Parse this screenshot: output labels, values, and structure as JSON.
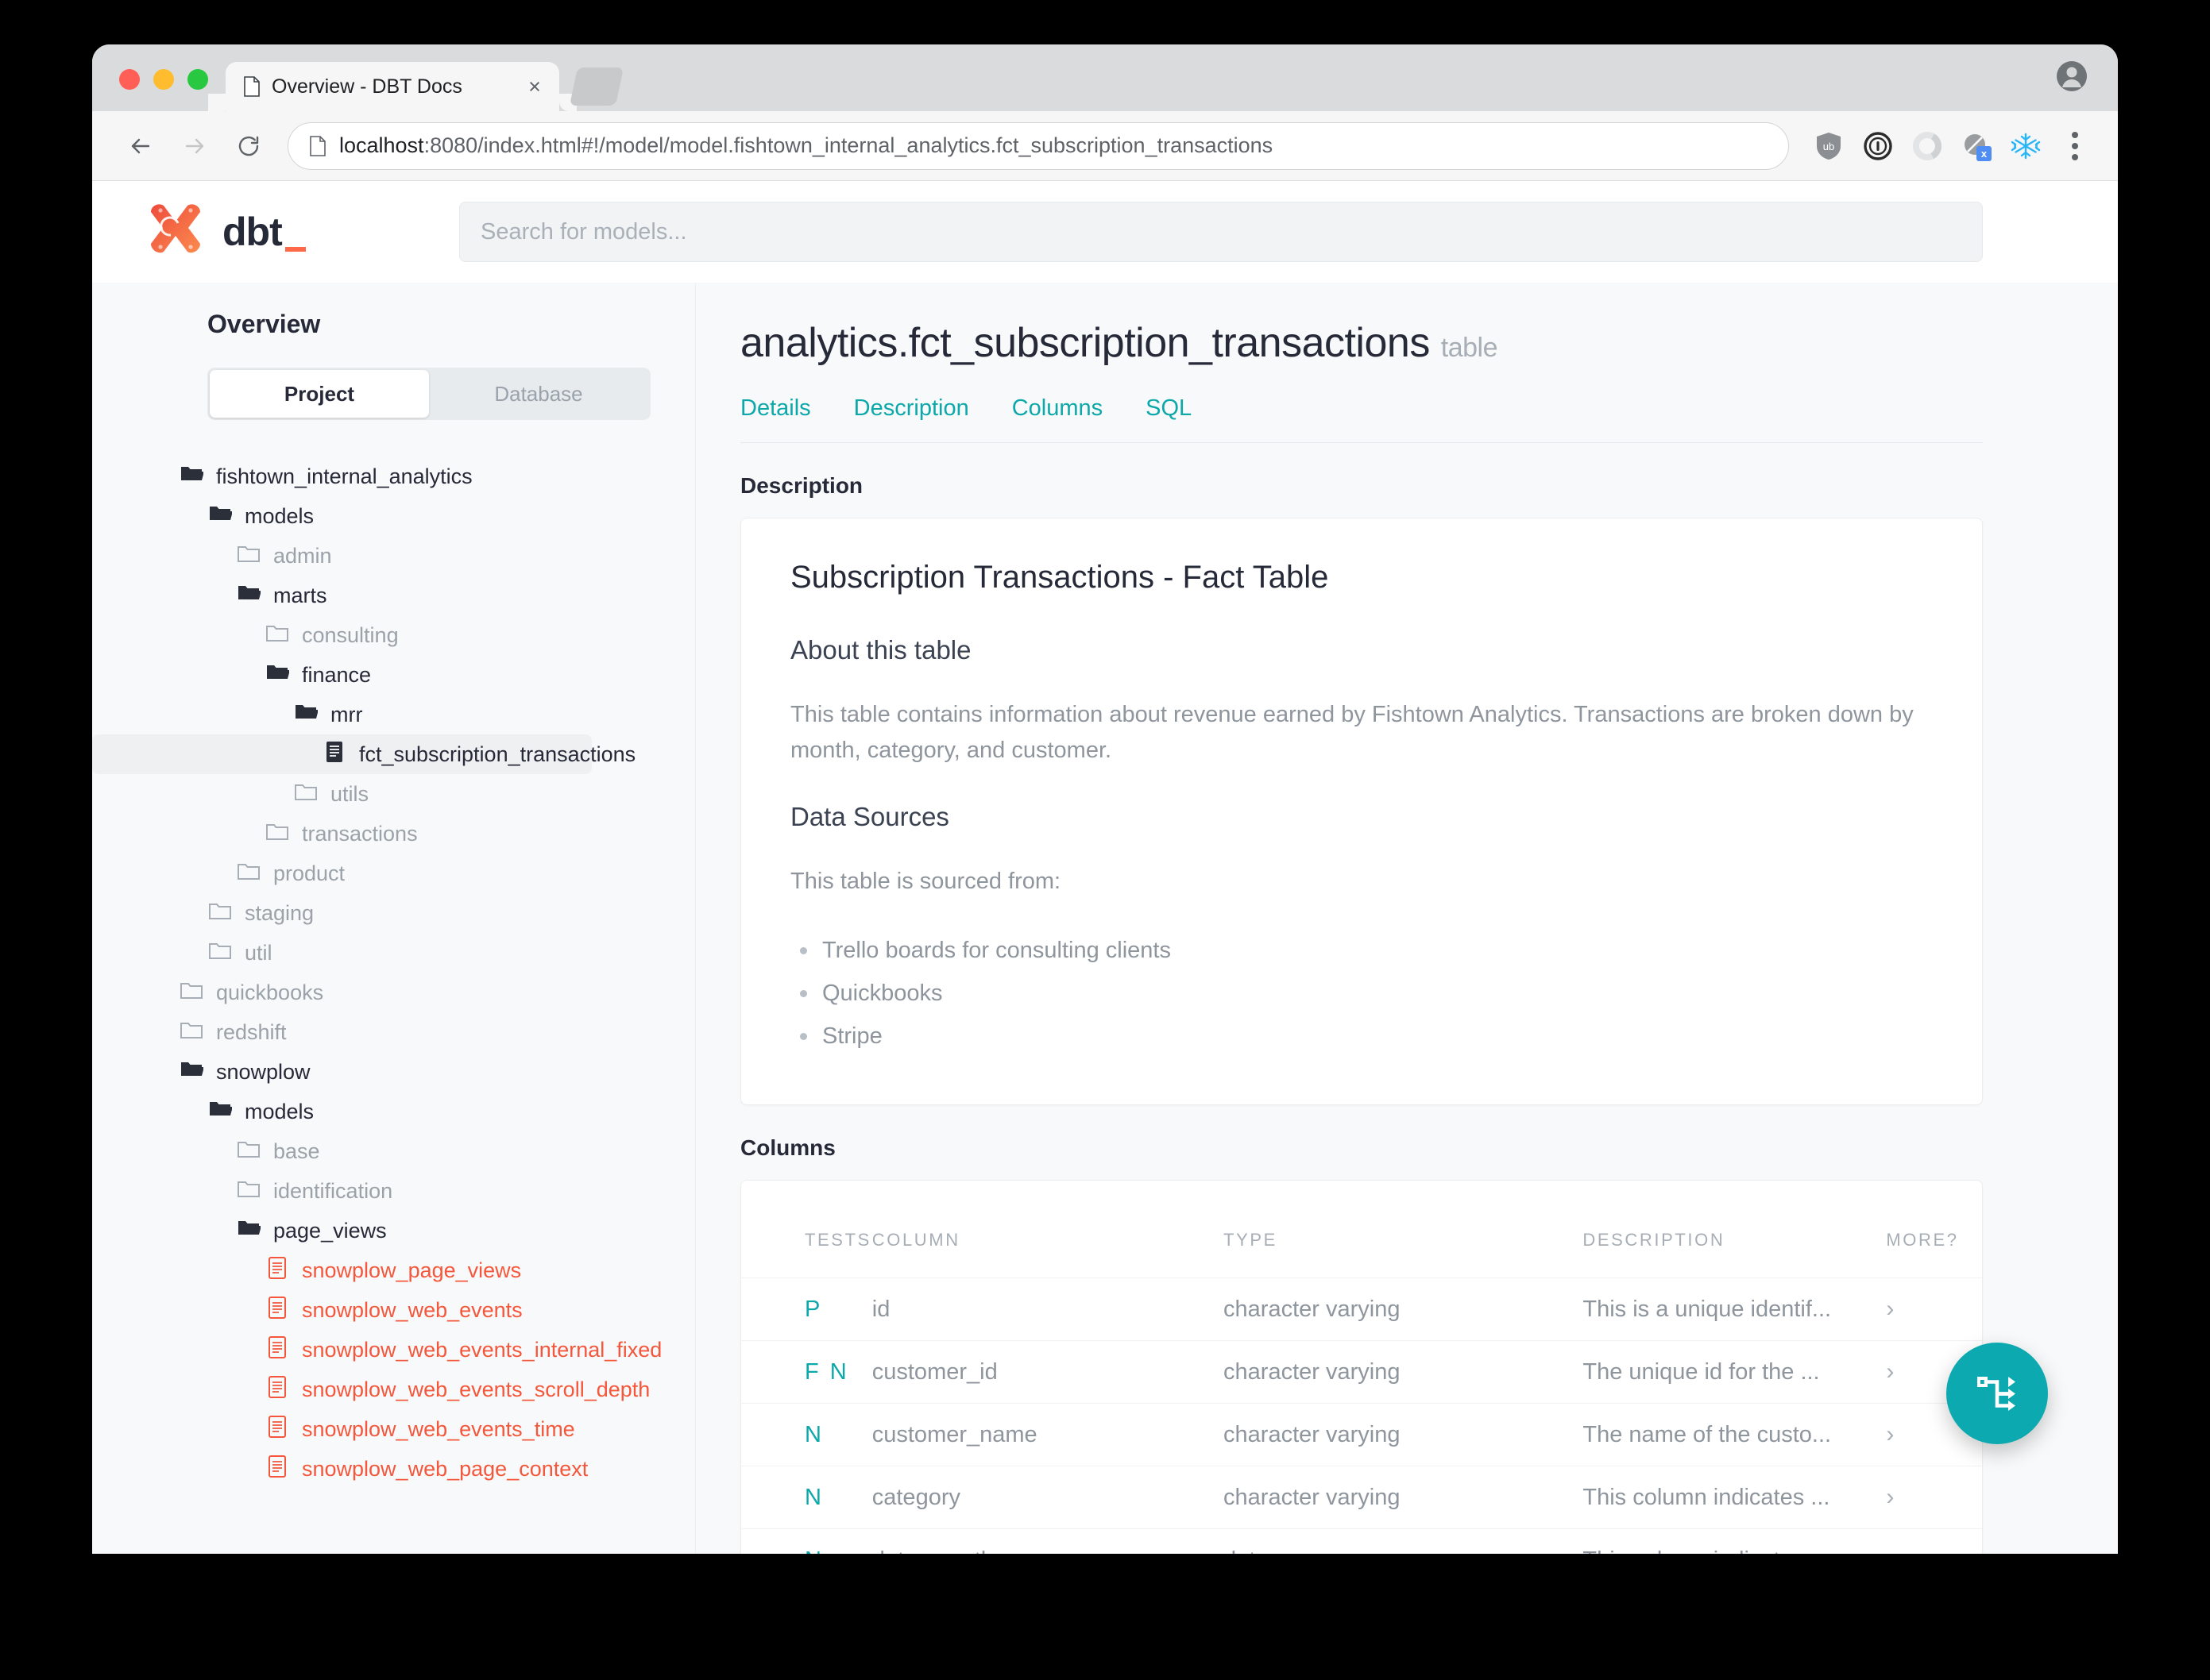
{
  "browser": {
    "tab_title": "Overview - DBT Docs",
    "tab_close_label": "×",
    "url_host": "localhost",
    "url_rest": ":8080/index.html#!/model/model.fishtown_internal_analytics.fct_subscription_transactions",
    "extensions": [
      "ublock-origin-icon",
      "1password-icon",
      "ring-icon",
      "blocked-x-icon",
      "snowflake-icon"
    ]
  },
  "app": {
    "logo_text": "dbt",
    "search": {
      "placeholder": "Search for models...",
      "value": ""
    }
  },
  "sidebar": {
    "title": "Overview",
    "toggle": {
      "project": "Project",
      "database": "Database",
      "active": "Project"
    },
    "tree": [
      {
        "label": "fishtown_internal_analytics",
        "depth": 0,
        "state": "open"
      },
      {
        "label": "models",
        "depth": 1,
        "state": "open"
      },
      {
        "label": "admin",
        "depth": 2,
        "state": "closed"
      },
      {
        "label": "marts",
        "depth": 2,
        "state": "open"
      },
      {
        "label": "consulting",
        "depth": 3,
        "state": "closed"
      },
      {
        "label": "finance",
        "depth": 3,
        "state": "open"
      },
      {
        "label": "mrr",
        "depth": 4,
        "state": "open"
      },
      {
        "label": "fct_subscription_transactions",
        "depth": 5,
        "state": "file",
        "selected": true
      },
      {
        "label": "utils",
        "depth": 4,
        "state": "closed"
      },
      {
        "label": "transactions",
        "depth": 3,
        "state": "closed"
      },
      {
        "label": "product",
        "depth": 2,
        "state": "closed"
      },
      {
        "label": "staging",
        "depth": 1,
        "state": "closed"
      },
      {
        "label": "util",
        "depth": 1,
        "state": "closed"
      },
      {
        "label": "quickbooks",
        "depth": 0,
        "state": "closed"
      },
      {
        "label": "redshift",
        "depth": 0,
        "state": "closed"
      },
      {
        "label": "snowplow",
        "depth": 0,
        "state": "open"
      },
      {
        "label": "models",
        "depth": 1,
        "state": "open"
      },
      {
        "label": "base",
        "depth": 2,
        "state": "closed"
      },
      {
        "label": "identification",
        "depth": 2,
        "state": "closed"
      },
      {
        "label": "page_views",
        "depth": 2,
        "state": "open"
      },
      {
        "label": "snowplow_page_views",
        "depth": 3,
        "state": "model"
      },
      {
        "label": "snowplow_web_events",
        "depth": 3,
        "state": "model"
      },
      {
        "label": "snowplow_web_events_internal_fixed",
        "depth": 3,
        "state": "model"
      },
      {
        "label": "snowplow_web_events_scroll_depth",
        "depth": 3,
        "state": "model"
      },
      {
        "label": "snowplow_web_events_time",
        "depth": 3,
        "state": "model"
      },
      {
        "label": "snowplow_web_page_context",
        "depth": 3,
        "state": "model"
      }
    ]
  },
  "main": {
    "title": "analytics.fct_subscription_transactions",
    "kind": "table",
    "tabs": [
      "Details",
      "Description",
      "Columns",
      "SQL"
    ],
    "description_label": "Description",
    "description": {
      "heading": "Subscription Transactions - Fact Table",
      "sub_heading_1": "About this table",
      "paragraph_1": "This table contains information about revenue earned by Fishtown Analytics. Transactions are broken down by month, category, and customer.",
      "sub_heading_2": "Data Sources",
      "paragraph_2": "This table is sourced from:",
      "sources": [
        "Trello boards for consulting clients",
        "Quickbooks",
        "Stripe"
      ]
    },
    "columns_label": "Columns",
    "columns_table": {
      "headers": [
        "TESTS",
        "COLUMN",
        "TYPE",
        "DESCRIPTION",
        "MORE?"
      ],
      "rows": [
        {
          "tests": [
            "P"
          ],
          "column": "id",
          "type": "character varying",
          "description": "This is a unique identif...",
          "more": "›"
        },
        {
          "tests": [
            "F",
            "N"
          ],
          "column": "customer_id",
          "type": "character varying",
          "description": "The unique id for the ...",
          "more": "›"
        },
        {
          "tests": [
            "N"
          ],
          "column": "customer_name",
          "type": "character varying",
          "description": "The name of the custo...",
          "more": "›"
        },
        {
          "tests": [
            "N"
          ],
          "column": "category",
          "type": "character varying",
          "description": "This column indicates ...",
          "more": "›"
        },
        {
          "tests": [
            "N"
          ],
          "column": "date_month",
          "type": "date",
          "description": "This column indicates ...",
          "more": "›"
        }
      ]
    },
    "fab_name": "lineage-graph-button"
  },
  "colors": {
    "teal": "#0ca8aa",
    "orange": "#f4573b",
    "dark": "#262a38",
    "muted": "#8e959d"
  }
}
